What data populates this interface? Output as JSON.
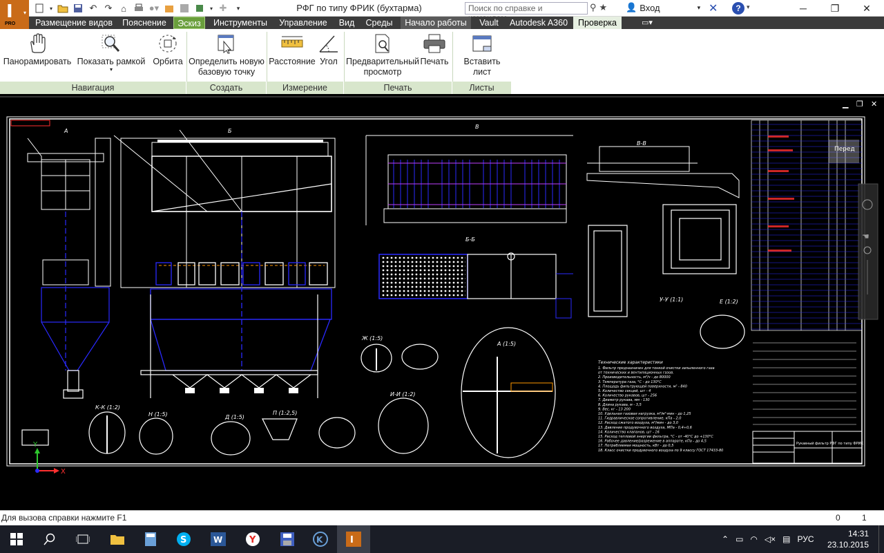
{
  "app": {
    "title": "РФГ по типу  ФРИК (бухтарма)",
    "icon_letter": "I",
    "icon_badge": "PRO"
  },
  "search": {
    "placeholder": "Поиск по справке и командам..."
  },
  "login": {
    "label": "Вход"
  },
  "help": {
    "label": "?"
  },
  "menu_tabs": [
    "Размещение видов",
    "Пояснение",
    "Эскиз",
    "Инструменты",
    "Управление",
    "Вид",
    "Среды",
    "Начало работы",
    "Vault",
    "Autodesk A360",
    "Проверка"
  ],
  "ribbon": {
    "tools": {
      "pan": "Панорамировать",
      "zoom_window": "Показать рамкой",
      "orbit": "Орбита",
      "new_base_point_1": "Определить новую",
      "new_base_point_2": "базовую точку",
      "distance": "Расстояние",
      "angle": "Угол",
      "preview_1": "Предварительный",
      "preview_2": "просмотр",
      "print": "Печать",
      "insert_sheet": "Вставить лист"
    },
    "panels": {
      "navigation": "Навигация",
      "create": "Создать",
      "measure": "Измерение",
      "print": "Печать",
      "sheets": "Листы"
    }
  },
  "drawing": {
    "view_labels": {
      "bb": "Б-Б",
      "vv": "В-В",
      "kk": "К-К (1:2)",
      "ii": "И-И (1:2)",
      "uu": "У-У (1:1)",
      "a15": "А (1:5)",
      "zh15": "Ж (1:5)",
      "e12": "Е (1:2)",
      "n15": "Н (1:5)",
      "d15": "Д (1:5)",
      "p125": "П (1:2,5)",
      "a_top": "А",
      "b_top": "Б",
      "v_top": "В"
    },
    "tech_title": "Технические характеристики",
    "tech_lines": [
      "1. Фильтр предназначен для тонкой очистки запыленного газа",
      "   от технических и вентиляционных газов.",
      "2. Производительность, м³/ч - до 80000",
      "3. Температура газа, °С - до 130°С",
      "4. Площадь фильтрующей поверхности, м² - 840",
      "5. Количество секций, шт - 4",
      "6. Количество рукавов, шт - 256",
      "7. Диаметр рукава, мм - 130",
      "8. Длина рукава, м - 3,5",
      "9. Вес, кг - 13 200",
      "10. Удельная газовая нагрузка, м³/м²·мин - до 1,25",
      "11. Гидравлическое сопротивление, кПа - 2,0",
      "12. Расход сжатого воздуха, м³/мин - до 3,0",
      "13. Давление продувочного воздуха, МПа - 0,4÷0,6",
      "14. Количество клапанов, шт - 16",
      "15. Расход тепловой энергии фильтра, °С - от -40°С до +130°С",
      "16. Рабочее давление/разрежение в аппарате, кПа - до 4,5",
      "17. Потребляемая мощность, кВт - до 0,5",
      "18. Класс очистки продувочного воздуха по 9 классу ГОСТ 17433-80"
    ],
    "stamp_text": "Рукавный фильтр РФГ по типу ФРИК",
    "sheet_tag": "Перед"
  },
  "status": {
    "help_hint": "Для вызова справки нажмите F1",
    "val0": "0",
    "val1": "1"
  },
  "taskbar": {
    "language": "РУС",
    "time": "14:31",
    "date": "23.10.2015"
  },
  "colors": {
    "accent_green": "#6a9f3c",
    "panel_green": "#d8e6cc",
    "drawing_white": "#ffffff",
    "drawing_blue": "#2a2aff",
    "drawing_red": "#ff3030",
    "drawing_magenta": "#c040ff",
    "drawing_orange": "#ff9900"
  }
}
